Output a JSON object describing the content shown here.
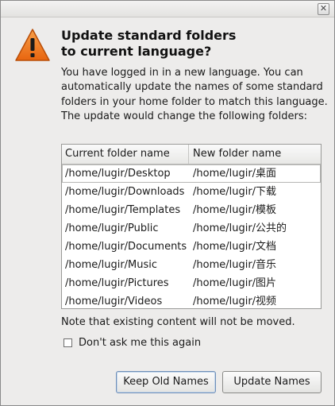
{
  "window": {
    "close_glyph": "✕"
  },
  "icon": {
    "name": "warning-icon",
    "color": "#f07a1c",
    "mark": "!"
  },
  "heading": "Update standard folders\nto current language?",
  "message": "You have logged in in a new language. You can automatically update the names of some standard folders in your home folder to match this language. The update would change the following folders:",
  "table": {
    "headers": [
      "Current folder name",
      "New folder name"
    ],
    "rows": [
      [
        "/home/lugir/Desktop",
        "/home/lugir/桌面"
      ],
      [
        "/home/lugir/Downloads",
        "/home/lugir/下载"
      ],
      [
        "/home/lugir/Templates",
        "/home/lugir/模板"
      ],
      [
        "/home/lugir/Public",
        "/home/lugir/公共的"
      ],
      [
        "/home/lugir/Documents",
        "/home/lugir/文档"
      ],
      [
        "/home/lugir/Music",
        "/home/lugir/音乐"
      ],
      [
        "/home/lugir/Pictures",
        "/home/lugir/图片"
      ],
      [
        "/home/lugir/Videos",
        "/home/lugir/视频"
      ]
    ]
  },
  "note": "Note that existing content will not be moved.",
  "checkbox": {
    "label": "Don't ask me this again",
    "checked": false
  },
  "buttons": {
    "keep": "Keep Old Names",
    "update": "Update Names"
  }
}
